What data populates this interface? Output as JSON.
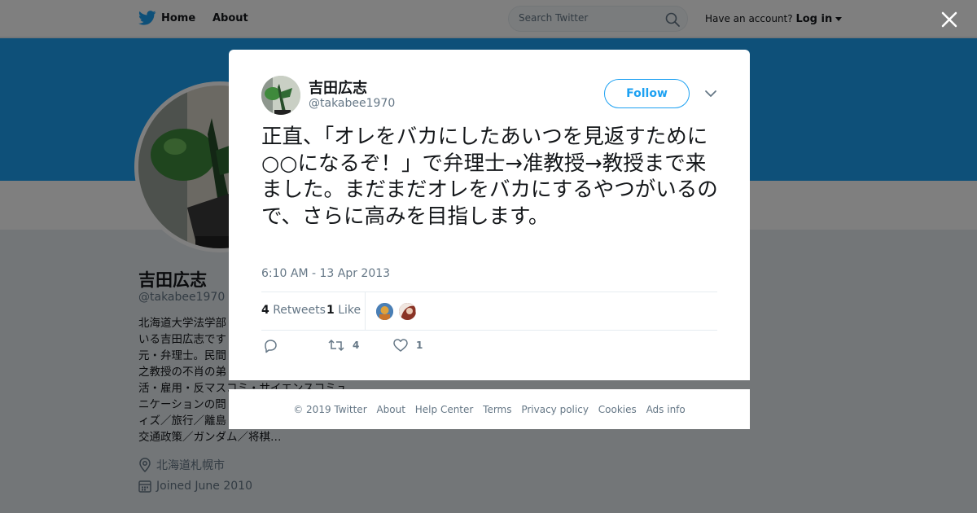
{
  "topbar": {
    "home_label": "Home",
    "about_label": "About",
    "search_placeholder": "Search Twitter",
    "account_prompt": "Have an account?",
    "login_label": "Log in"
  },
  "profile": {
    "name": "吉田広志",
    "handle": "@takabee1970",
    "bio": "北海道大学法学部…いる吉田広志です…元・弁理士。民間…之教授の不肖の弟…活・雇用・反マスコミ・サイエンスコミュニケーションの問…ィズ／旅行／離島…交通政策／ガンダム／将棋…",
    "bio_lines": [
      "北海道大学法学部",
      "いる吉田広志です",
      "元・弁理士。民間",
      "之教授の不肖の弟",
      "活・雇用・反マスコミ・サイエンスコミュ",
      "ニケーションの問",
      "ィズ／旅行／離島",
      "交通政策／ガンダム／将棋…"
    ],
    "location": "北海道札幌市",
    "joined": "Joined June 2010"
  },
  "tweet": {
    "author_name": "吉田広志",
    "author_handle": "@takabee1970",
    "follow_label": "Follow",
    "text": "正直、「オレをバカにしたあいつを見返すために○○になるぞ！」で弁理士→准教授→教授まで来ました。まだまだオレをバカにするやつがいるので、さらに高みを目指します。",
    "timestamp": "6:10 AM - 13 Apr 2013",
    "retweet_count": "4",
    "retweets_label": "Retweets",
    "like_count": "1",
    "likes_label": "Like",
    "action_retweet_count": "4",
    "action_like_count": "1"
  },
  "footer": {
    "links": [
      "© 2019 Twitter",
      "About",
      "Help Center",
      "Terms",
      "Privacy policy",
      "Cookies",
      "Ads info"
    ]
  },
  "icons": {
    "logo": "twitter-bird-icon",
    "search": "search-icon",
    "close": "close-icon",
    "caret": "chevron-down-icon",
    "reply": "reply-icon",
    "retweet": "retweet-icon",
    "like": "heart-icon",
    "location": "location-pin-icon",
    "calendar": "calendar-icon"
  },
  "colors": {
    "brand": "#1da1f2",
    "text": "#14171a",
    "muted": "#657786",
    "background": "#e6ecf0"
  }
}
